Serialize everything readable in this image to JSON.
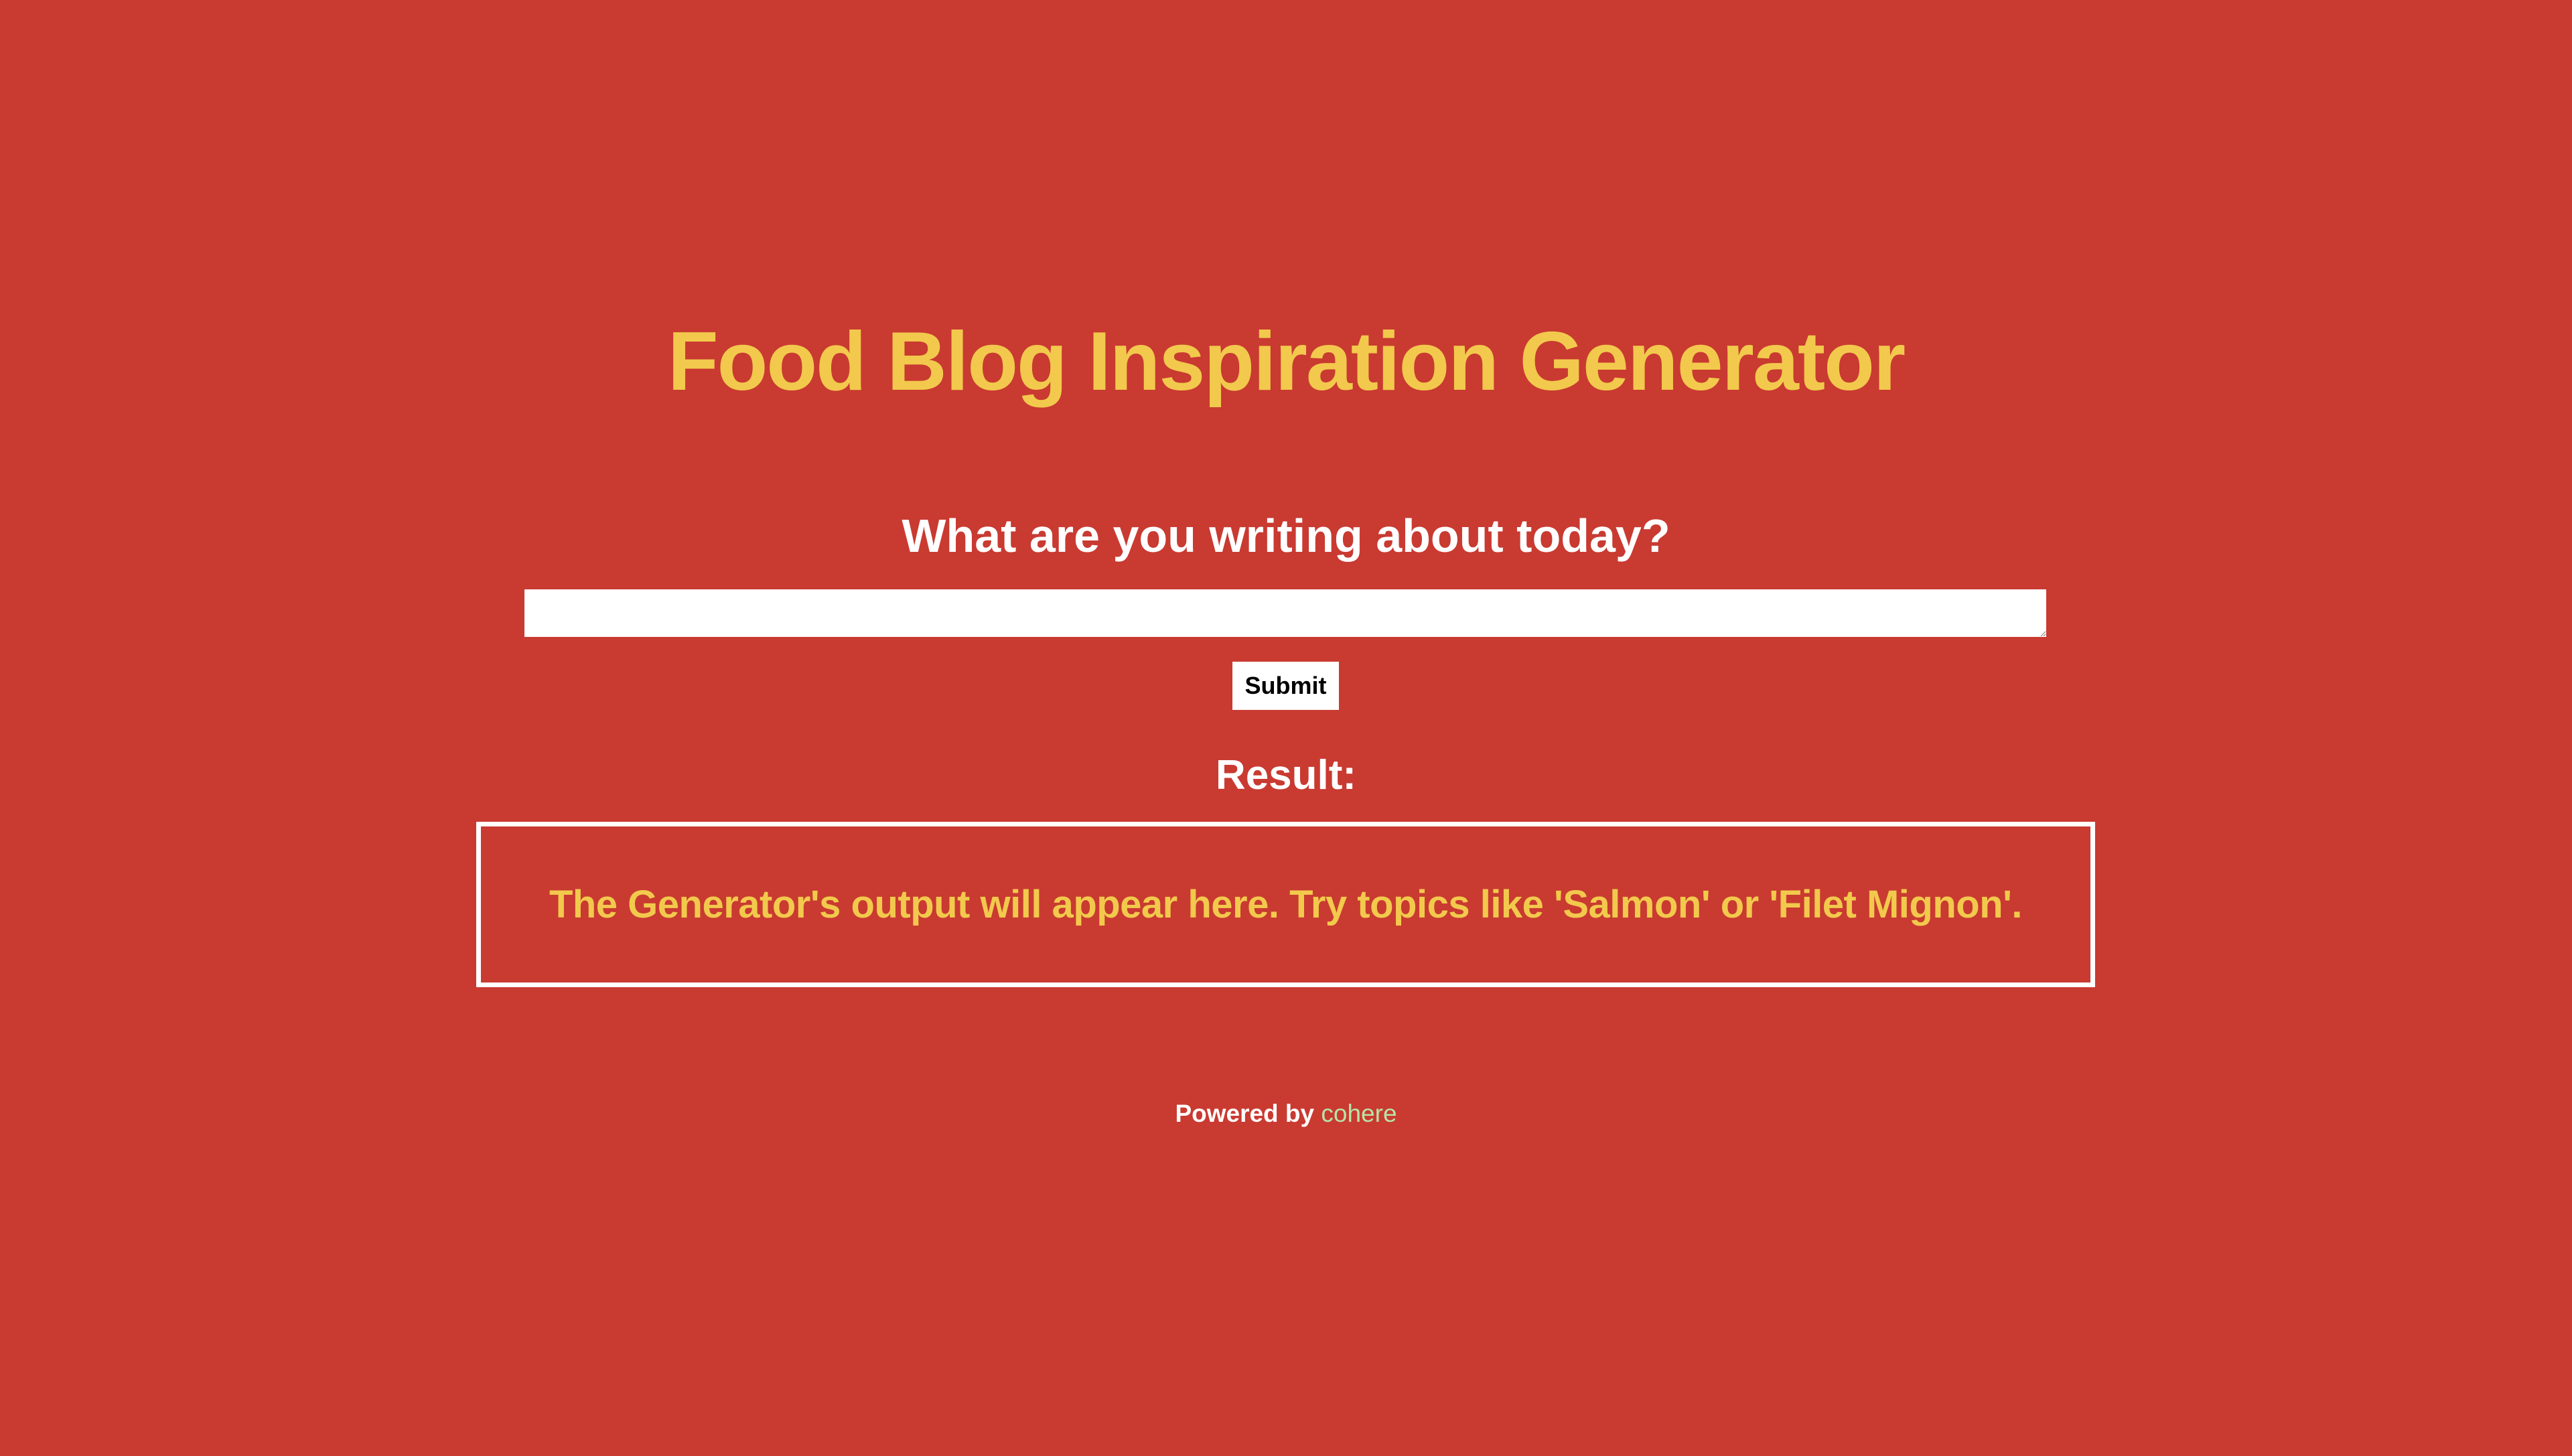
{
  "header": {
    "title": "Food Blog Inspiration Generator"
  },
  "form": {
    "prompt": "What are you writing about today?",
    "input_value": "",
    "submit_label": "Submit"
  },
  "result": {
    "heading": "Result:",
    "placeholder_text": "The Generator's output will appear here. Try topics like 'Salmon' or 'Filet Mignon'."
  },
  "footer": {
    "powered_by": "Powered by",
    "brand_link": "cohere"
  },
  "colors": {
    "background": "#c93a31",
    "title_accent": "#f2c94c",
    "text_primary": "#ffffff",
    "link_accent": "#b7e4a8"
  }
}
